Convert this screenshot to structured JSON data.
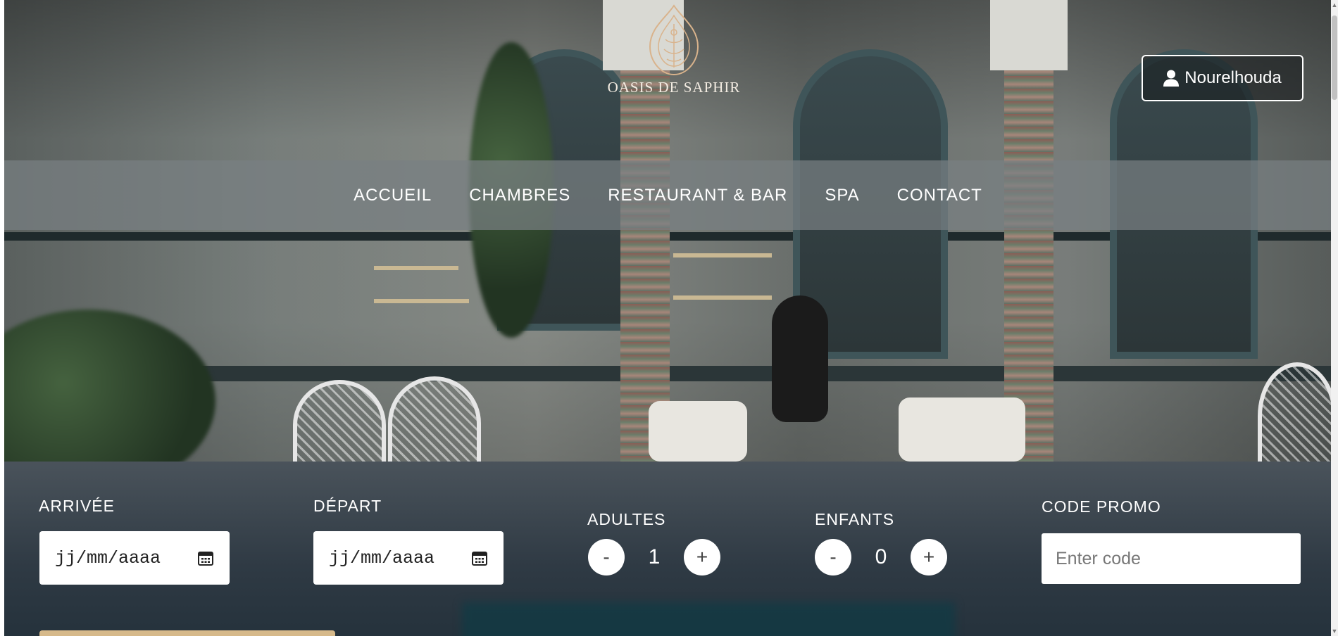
{
  "header": {
    "logo_text": "OASIS DE SAPHIR",
    "user_label": "Nourelhouda"
  },
  "nav": {
    "items": [
      {
        "label": "ACCUEIL"
      },
      {
        "label": "CHAMBRES"
      },
      {
        "label": "RESTAURANT & BAR"
      },
      {
        "label": "SPA"
      },
      {
        "label": "CONTACT"
      }
    ]
  },
  "booking": {
    "arrival": {
      "label": "ARRIVÉE",
      "value": "jj/mm/aaaa"
    },
    "departure": {
      "label": "DÉPART",
      "value": "jj/mm/aaaa"
    },
    "adults": {
      "label": "ADULTES",
      "minus": "-",
      "count": "1",
      "plus": "+"
    },
    "children": {
      "label": "ENFANTS",
      "minus": "-",
      "count": "0",
      "plus": "+"
    },
    "promo": {
      "label": "CODE PROMO",
      "placeholder": "Enter code"
    }
  },
  "colors": {
    "logo_gold": "#d9b38c",
    "nav_bar": "#787f82",
    "accent_strip": "#d6b98a"
  }
}
